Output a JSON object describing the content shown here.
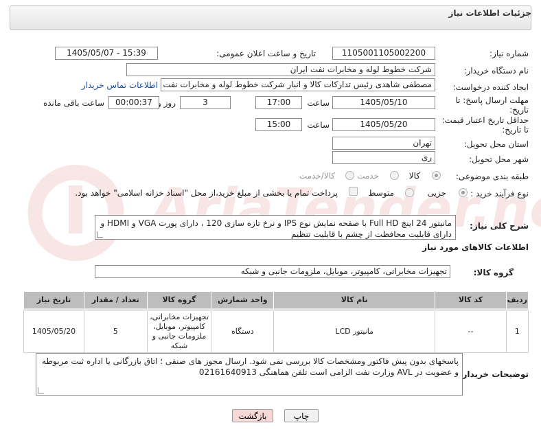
{
  "header": {
    "title": "جزئیات اطلاعات نیاز"
  },
  "fields": {
    "need_number_label": "شماره نیاز:",
    "need_number": "1105001105002200",
    "announce_label": "تاریخ و ساعت اعلان عمومی:",
    "announce_value": "1405/05/07 - 15:39",
    "buyer_label": "نام دستگاه خریدار:",
    "buyer_value": "شرکت خطوط لوله و مخابرات نفت ایران",
    "creator_label": "ایجاد کننده درخواست:",
    "creator_value": "مصطفی  شاهدی رئیس تدارکات کالا و انبار شرکت خطوط لوله و مخابرات نفت ایران",
    "contact_link": "اطلاعات تماس خریدار",
    "reply_label_1": "مهلت ارسال پاسخ: تا",
    "reply_label_2": "تاریخ:",
    "reply_date": "1405/05/10",
    "time_label": "ساعت",
    "reply_time": "17:00",
    "days_value": "3",
    "days_label": "روز و",
    "remaining_value": "00:00:37",
    "remaining_label": "ساعت باقی مانده",
    "price_label_1": "حداقل تاریخ اعتبار قیمت:",
    "price_label_2": "تا تاریخ:",
    "price_date": "1405/05/20",
    "price_time": "15:00",
    "province_label": "استان محل تحویل:",
    "province_value": "تهران",
    "city_label": "شهر محل تحویل:",
    "city_value": "ری",
    "category_label": "طبقه بندی موضوعی:",
    "category_options": [
      "کالا",
      "خدمت",
      "کالا/خدمت"
    ],
    "process_label": "نوع فرآیند خرید :",
    "process_options": [
      "جزیی",
      "متوسط"
    ],
    "payment_text": "پرداخت تمام یا بخشی از مبلغ خرید،از محل \"اسناد خزانه اسلامی\" خواهد بود."
  },
  "description": {
    "label": "شرح کلی نیاز:",
    "text": "مانیتور 24 اینچ Full HD  با صفحه نمایش نوع IPS  و نرخ تازه سازی 120 ، دارای پورت VGA  و HDMI  و دارای قابلیت محافظت از چشم با قابلیت تنظیم"
  },
  "goods_info": {
    "heading": "اطلاعات کالاهای مورد نیاز",
    "group_label": "گروه کالا:",
    "group_value": "تجهیزات مخابراتی، کامپیوتر، موبایل، ملزومات جانبی و شبکه"
  },
  "table": {
    "headers": [
      "ردیف",
      "کد کالا",
      "نام کالا",
      "واحد شمارش",
      "گروه کالا",
      "تعداد / مقدار",
      "تاریخ نیاز"
    ],
    "rows": [
      [
        "1",
        "--",
        "مانیتور LCD",
        "دستگاه",
        "تجهیزات مخابراتی، کامپیوتر، موبایل، ملزومات جانبی و شبکه",
        "5",
        "1405/05/20"
      ]
    ]
  },
  "buyer_notes": {
    "label": "توضیحات خریدار:",
    "text": "پاسخهای بدون پیش فاکتور ومشخصات کالا بررسی نمی شود. ارسال مجوز های صنفی ؛ اتاق بازرگانی یا اداره ثبت  مربوطه و عضویت در AVL وزارت نفت الزامی است تلفن هماهنگی  02161640913"
  },
  "buttons": {
    "print": "چاپ",
    "back": "بازگشت"
  },
  "colors": {
    "back_button_bg": "#f7d7d7",
    "header_bg": "#e9e9e9",
    "table_header_bg": "#bdbdbd"
  }
}
